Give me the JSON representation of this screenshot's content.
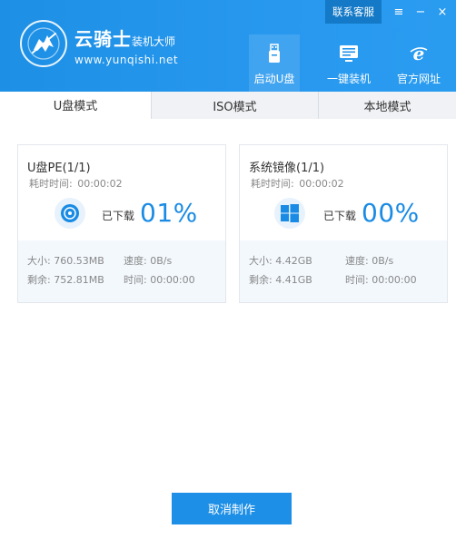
{
  "header": {
    "brand_name": "云骑士",
    "brand_suffix": "装机大师",
    "url": "www.yunqishi.net",
    "contact": "联系客服",
    "menu_glyph": "≡",
    "minimize_glyph": "−",
    "close_glyph": "×",
    "nav": [
      {
        "label": "启动U盘",
        "icon": "usb-icon"
      },
      {
        "label": "一键装机",
        "icon": "monitor-icon"
      },
      {
        "label": "官方网址",
        "icon": "ie-icon"
      }
    ],
    "color": "#2192e8"
  },
  "tabs": [
    "U盘模式",
    "ISO模式",
    "本地模式"
  ],
  "cards": [
    {
      "title": "U盘PE(1/1)",
      "elapsed_label": "耗时时间:",
      "elapsed": "00:00:02",
      "downloaded_label": "已下载",
      "percent": "01%",
      "icon": "disc-icon",
      "size_label": "大小:",
      "size": "760.53MB",
      "speed_label": "速度:",
      "speed": "0B/s",
      "remain_label": "剩余:",
      "remain": "752.81MB",
      "time_label": "时间:",
      "time": "00:00:00"
    },
    {
      "title": "系统镜像(1/1)",
      "elapsed_label": "耗时时间:",
      "elapsed": "00:00:02",
      "downloaded_label": "已下载",
      "percent": "00%",
      "icon": "windows-icon",
      "size_label": "大小:",
      "size": "4.42GB",
      "speed_label": "速度:",
      "speed": "0B/s",
      "remain_label": "剩余:",
      "remain": "4.41GB",
      "time_label": "时间:",
      "time": "00:00:00"
    }
  ],
  "cancel_label": "取消制作",
  "accent": "#1a8be4"
}
